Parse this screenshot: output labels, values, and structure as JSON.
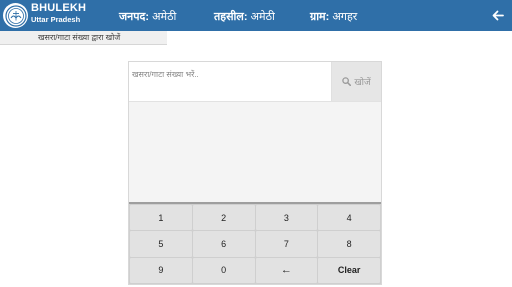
{
  "header": {
    "brand_title": "BHULEKH",
    "brand_sub": "Uttar Pradesh",
    "janpad_label": "जनपद:",
    "janpad_value": "अमेठी",
    "tehsil_label": "तहसील:",
    "tehsil_value": "अमेठी",
    "gram_label": "ग्राम:",
    "gram_value": "अगहर",
    "back_icon": "arrow-left-icon",
    "colors": {
      "bar": "#2f6fa8",
      "text": "#ffffff"
    }
  },
  "breadcrumb": {
    "label": "खसरा/गाटा संख्या द्वारा खोजें"
  },
  "search": {
    "placeholder": "खसरा/गाटा संख्या भरें..",
    "value": "",
    "button_label": "खोजें",
    "button_icon": "search-icon"
  },
  "keypad": {
    "keys": [
      {
        "label": "1"
      },
      {
        "label": "2"
      },
      {
        "label": "3"
      },
      {
        "label": "4"
      },
      {
        "label": "5"
      },
      {
        "label": "6"
      },
      {
        "label": "7"
      },
      {
        "label": "8"
      },
      {
        "label": "9"
      },
      {
        "label": "0"
      },
      {
        "label": "←",
        "icon": "backspace-arrow-icon"
      },
      {
        "label": "Clear"
      }
    ]
  }
}
